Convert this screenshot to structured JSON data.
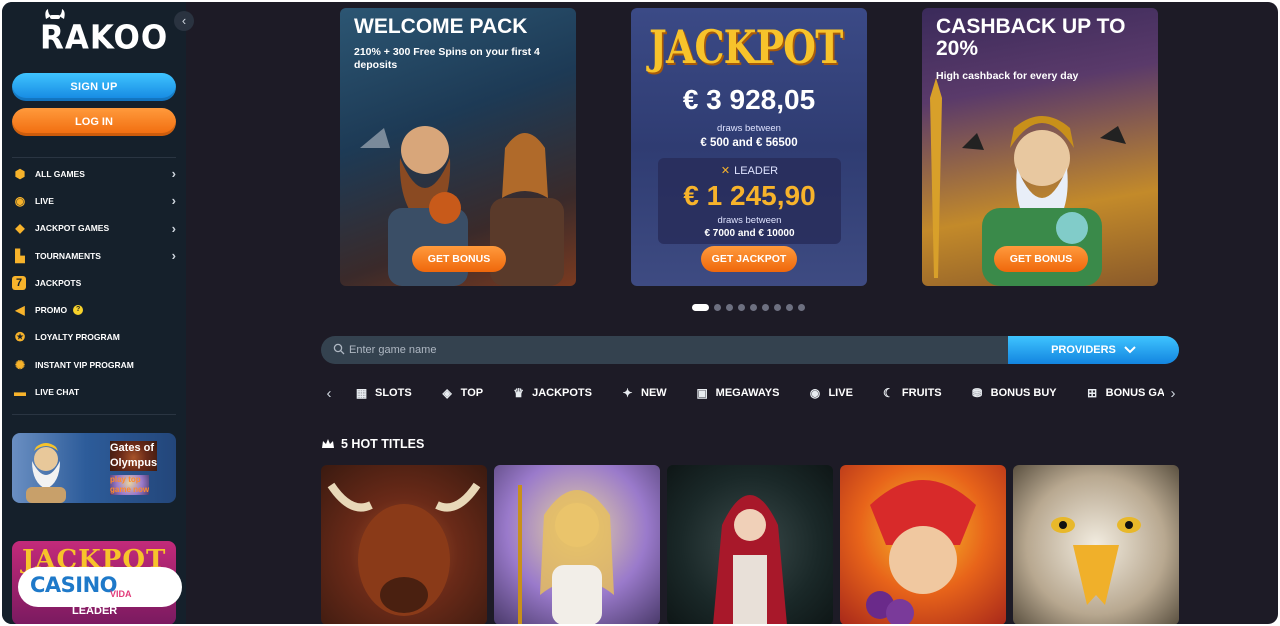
{
  "brand": {
    "logo_text": "RAKOO"
  },
  "sidebar": {
    "collapse_glyph": "‹",
    "signup_label": "SIGN UP",
    "login_label": "LOG IN",
    "items": [
      {
        "label": "ALL GAMES",
        "icon": "dice-icon",
        "glyph": "⬢",
        "chevron": "›"
      },
      {
        "label": "LIVE",
        "icon": "live-signal-icon",
        "glyph": "◉",
        "chevron": "›"
      },
      {
        "label": "JACKPOT GAMES",
        "icon": "diamond-icon",
        "glyph": "◆",
        "chevron": "›"
      },
      {
        "label": "TOURNAMENTS",
        "icon": "podium-icon",
        "glyph": "▙",
        "chevron": "›"
      },
      {
        "label": "JACKPOTS",
        "icon": "seven-icon",
        "glyph": "7",
        "chevron": ""
      },
      {
        "label": "PROMO",
        "icon": "megaphone-icon",
        "glyph": "◀",
        "chevron": "",
        "badge": "?"
      },
      {
        "label": "LOYALTY PROGRAM",
        "icon": "medal-icon",
        "glyph": "✪",
        "chevron": ""
      },
      {
        "label": "INSTANT VIP PROGRAM",
        "icon": "vip-badge-icon",
        "glyph": "✺",
        "chevron": ""
      },
      {
        "label": "LIVE CHAT",
        "icon": "chat-icon",
        "glyph": "▬",
        "chevron": ""
      }
    ],
    "promo_card": {
      "title_line1": "Gates of",
      "title_line2": "Olympus",
      "sub_line1": "play top",
      "sub_line2": "game now"
    },
    "side_jackpot": {
      "title": "JACKPOT",
      "leader": "LEADER"
    },
    "watermark": {
      "main": "CASINO",
      "sub": "VIDA"
    }
  },
  "banners": [
    {
      "title": "WELCOME PACK",
      "subtitle_line1": "210% + 300 Free Spins on your first 4",
      "subtitle_line2": "deposits",
      "button": "GET BONUS"
    },
    {
      "title": "JACKPOT",
      "amount": "€ 3 928,05",
      "draws_label": "draws between",
      "draws_range": "€ 500 and € 56500",
      "leader_label": "LEADER",
      "leader_amount": "€ 1 245,90",
      "leader_draws_label": "draws between",
      "leader_draws_range": "€ 7000 and € 10000",
      "button": "GET JACKPOT"
    },
    {
      "title_line1": "CASHBACK UP TO",
      "title_line2": "20%",
      "subtitle": "High cashback for every day",
      "button": "GET BONUS"
    }
  ],
  "carousel": {
    "total": 10,
    "active_index": 0
  },
  "search": {
    "placeholder": "Enter game name",
    "value": "",
    "providers_label": "PROVIDERS"
  },
  "categories": {
    "prev_glyph": "‹",
    "next_glyph": "›",
    "items": [
      {
        "label": "SLOTS",
        "icon": "slot-machine-icon",
        "glyph": "▦"
      },
      {
        "label": "TOP",
        "icon": "top-icon",
        "glyph": "◈"
      },
      {
        "label": "JACKPOTS",
        "icon": "jackpot-777-icon",
        "glyph": "♛"
      },
      {
        "label": "NEW",
        "icon": "new-sparkle-icon",
        "glyph": "✦"
      },
      {
        "label": "MEGAWAYS",
        "icon": "megaways-icon",
        "glyph": "▣"
      },
      {
        "label": "LIVE",
        "icon": "live-signal-icon",
        "glyph": "◉"
      },
      {
        "label": "FRUITS",
        "icon": "banana-icon",
        "glyph": "☾"
      },
      {
        "label": "BONUS BUY",
        "icon": "bonus-buy-icon",
        "glyph": "⛃"
      },
      {
        "label": "BONUS GA",
        "icon": "gift-icon",
        "glyph": "⊞"
      }
    ]
  },
  "hot_titles": {
    "label": "5 HOT TITLES"
  },
  "colors": {
    "accent_orange": "#f06a0c",
    "accent_blue": "#1385e0",
    "gold": "#f7b32b",
    "bg": "#1d1b26",
    "sidebar_bg": "#15202b"
  }
}
